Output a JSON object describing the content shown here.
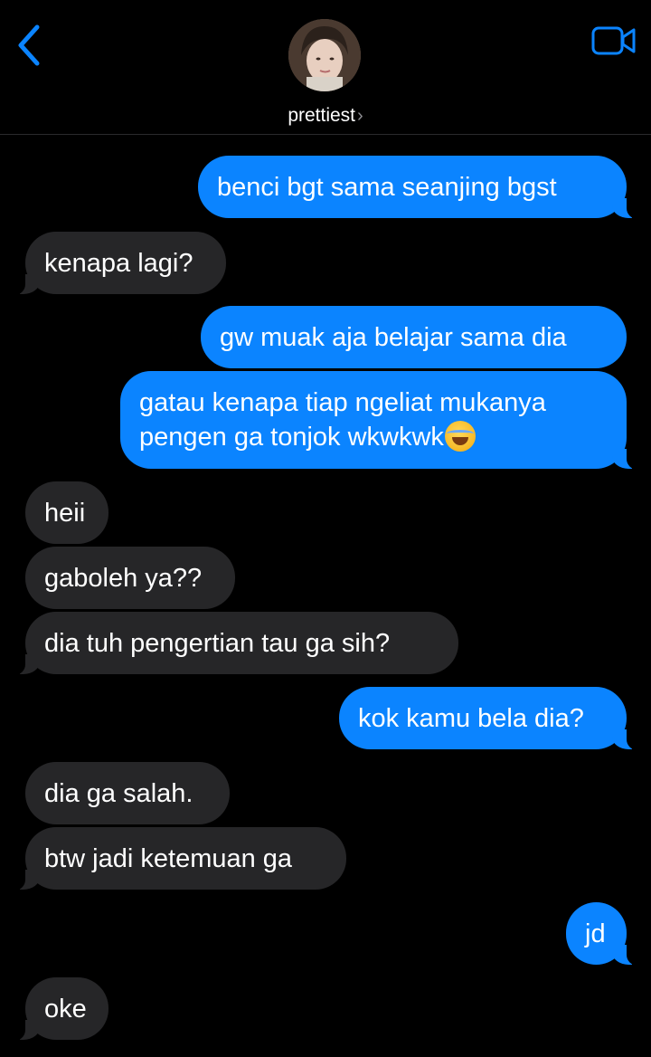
{
  "header": {
    "contact_name": "prettiest",
    "name_chevron": "›",
    "back_icon": "chevron-left",
    "video_icon": "video-camera",
    "accent_color": "#0b84ff"
  },
  "messages": [
    {
      "direction": "out",
      "text": "benci bgt sama seanjing bgst"
    },
    {
      "direction": "in",
      "text": "kenapa lagi?"
    },
    {
      "direction": "out",
      "text": "gw muak aja belajar sama dia"
    },
    {
      "direction": "out",
      "lines": [
        "gatau kenapa tiap ngeliat mukanya",
        "pengen ga tonjok wkwkwk"
      ],
      "emoji": "face-with-tears-of-joy"
    },
    {
      "direction": "in",
      "text": "heii"
    },
    {
      "direction": "in",
      "text": "gaboleh ya??"
    },
    {
      "direction": "in",
      "text": "dia tuh pengertian tau ga sih?"
    },
    {
      "direction": "out",
      "text": "kok kamu bela dia?"
    },
    {
      "direction": "in",
      "text": "dia ga salah."
    },
    {
      "direction": "in",
      "text": "btw jadi ketemuan ga"
    },
    {
      "direction": "out",
      "text": "jd"
    },
    {
      "direction": "in",
      "text": "oke"
    }
  ]
}
